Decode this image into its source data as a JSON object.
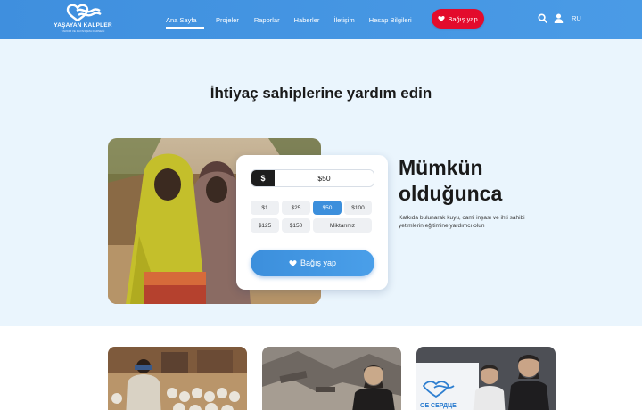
{
  "header": {
    "logo": {
      "name": "YAŞAYAN KALPLER",
      "tagline": "YARDIM VE DAYANIŞMA DERNEĞİ",
      "icon": "heart-waves-logo"
    },
    "nav": [
      {
        "label": "Ana Sayfa",
        "active": true
      },
      {
        "label": "Projeler",
        "active": false
      },
      {
        "label": "Raporlar",
        "active": false
      },
      {
        "label": "Haberler",
        "active": false
      },
      {
        "label": "İletişim",
        "active": false
      },
      {
        "label": "Hesap Bilgileri",
        "active": false
      }
    ],
    "donate_label": "Bağış yap",
    "search_icon": "search-icon",
    "user_icon": "user-icon",
    "language": "RU"
  },
  "hero": {
    "title": "İhtiyaç sahiplerine yardım edin",
    "side_title": "Mümkün olduğunca",
    "side_description": "Katkıda bulunarak kuyu, cami inşası ve ihti sahibi yetimlerin eğitimine yardımcı olun"
  },
  "donation": {
    "currency_symbol": "$",
    "amount": "$50",
    "presets": [
      "$1",
      "$25",
      "$50",
      "$100",
      "$125",
      "$150",
      "Miktarınız"
    ],
    "selected": "$50",
    "button_label": "Bağış yap"
  },
  "news_cards": [
    {
      "image": "gathering-photo"
    },
    {
      "image": "ruins-photo"
    },
    {
      "image": "volunteers-photo",
      "banner_text": "ОЕ СЕРДЦЕ"
    }
  ],
  "colors": {
    "header_blue": "#4a9be6",
    "hero_background": "#eaf5fd",
    "accent_blue": "#3c8fdc",
    "donate_red": "#e30b2c"
  }
}
